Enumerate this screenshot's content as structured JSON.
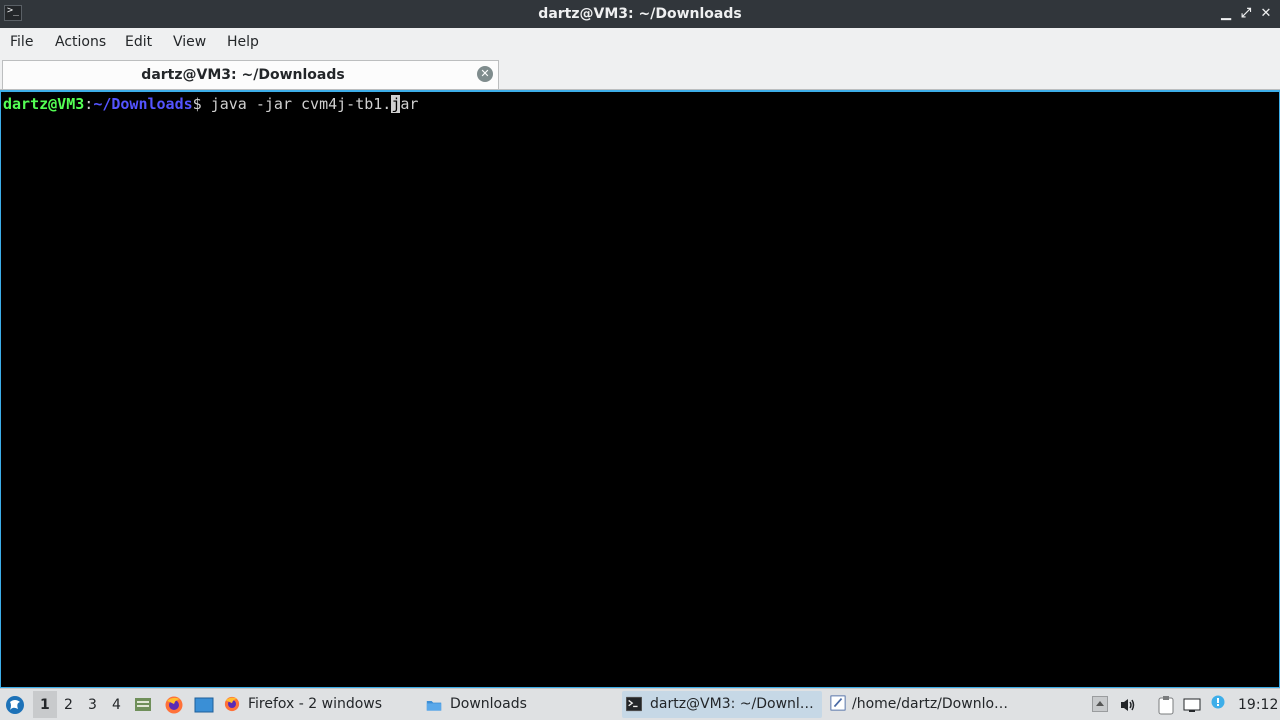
{
  "window": {
    "title": "dartz@VM3: ~/Downloads",
    "minimize": "▁",
    "maximize": "⤢",
    "close": "✕"
  },
  "menu": {
    "items": [
      "File",
      "Actions",
      "Edit",
      "View",
      "Help"
    ]
  },
  "tab": {
    "label": "dartz@VM3: ~/Downloads",
    "close": "✕"
  },
  "terminal": {
    "prompt_user": "dartz@VM3",
    "prompt_sep": ":",
    "prompt_path": "~/Downloads",
    "prompt_sym": "$ ",
    "command_before_cursor": "java -jar cvm4j-tb1.",
    "cursor_char": "j",
    "command_after_cursor": "ar"
  },
  "taskbar": {
    "desktops": [
      "1",
      "2",
      "3",
      "4"
    ],
    "active_desktop": "1",
    "tasks": [
      {
        "label": "Firefox - 2 windows",
        "icon": "firefox-icon"
      },
      {
        "label": "Downloads",
        "icon": "folder-icon"
      },
      {
        "label": "dartz@VM3: ~/Downl…",
        "icon": "terminal-icon"
      },
      {
        "label": "/home/dartz/Downlo…",
        "icon": "text-editor-icon"
      }
    ],
    "clock": "19:12"
  },
  "colors": {
    "accent": "#3daee9",
    "prompt_user": "#54ff54",
    "prompt_path": "#5454ff"
  }
}
